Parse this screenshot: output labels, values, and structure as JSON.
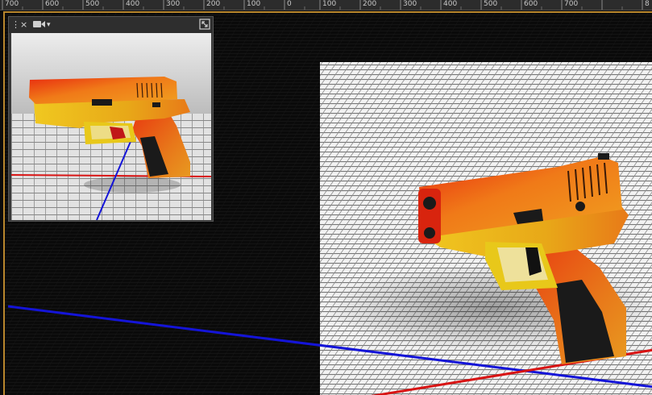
{
  "ruler": {
    "labels": [
      "700",
      "600",
      "500",
      "400",
      "300",
      "200",
      "100",
      "0",
      "100",
      "200",
      "300",
      "400",
      "500",
      "600",
      "700",
      "8"
    ]
  },
  "camera_panel": {
    "icons": [
      "drag-handle-icon",
      "close-icon",
      "camera-icon",
      "dropdown-arrow-icon",
      "maximize-icon"
    ],
    "close_glyph": "×",
    "drag_glyph": "⋮",
    "arrow_glyph": "▾"
  },
  "colors": {
    "frame_gold": "#b8862c",
    "x_axis_red": "#d01818",
    "z_axis_blue": "#1010d0",
    "gun_orange": "#e8641a",
    "gun_yellow": "#e8c81a",
    "grip_dark": "#1a1a1a"
  }
}
